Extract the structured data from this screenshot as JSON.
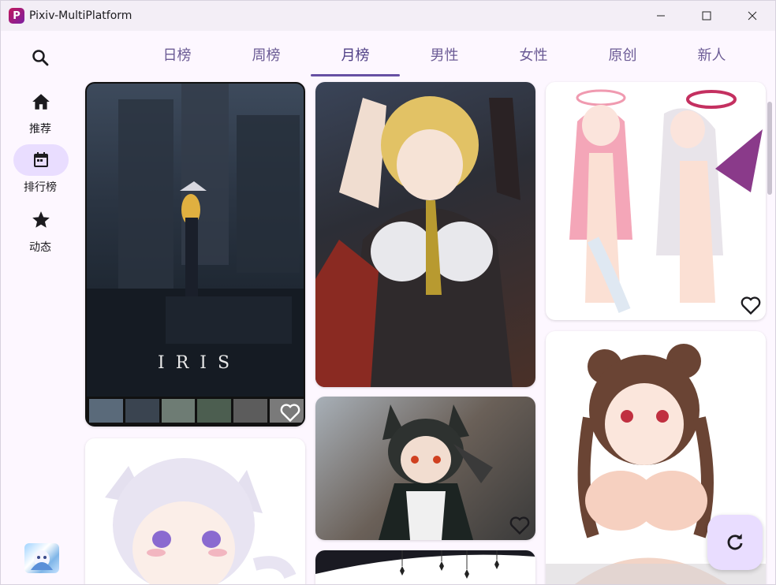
{
  "window": {
    "title": "Pixiv-MultiPlatform"
  },
  "sidebar": {
    "items": [
      {
        "label": "推荐",
        "icon": "home-icon"
      },
      {
        "label": "排行榜",
        "icon": "calendar-icon",
        "active": true
      },
      {
        "label": "动态",
        "icon": "star-icon"
      }
    ]
  },
  "tabs": [
    {
      "label": "日榜"
    },
    {
      "label": "周榜"
    },
    {
      "label": "月榜",
      "active": true
    },
    {
      "label": "男性"
    },
    {
      "label": "女性"
    },
    {
      "label": "原创"
    },
    {
      "label": "新人"
    }
  ],
  "artworks": {
    "iris": {
      "overlay_text": "IRIS"
    }
  },
  "colors": {
    "accent": "#6750a4",
    "pill": "#e9ddff",
    "background": "#fdf7ff"
  }
}
